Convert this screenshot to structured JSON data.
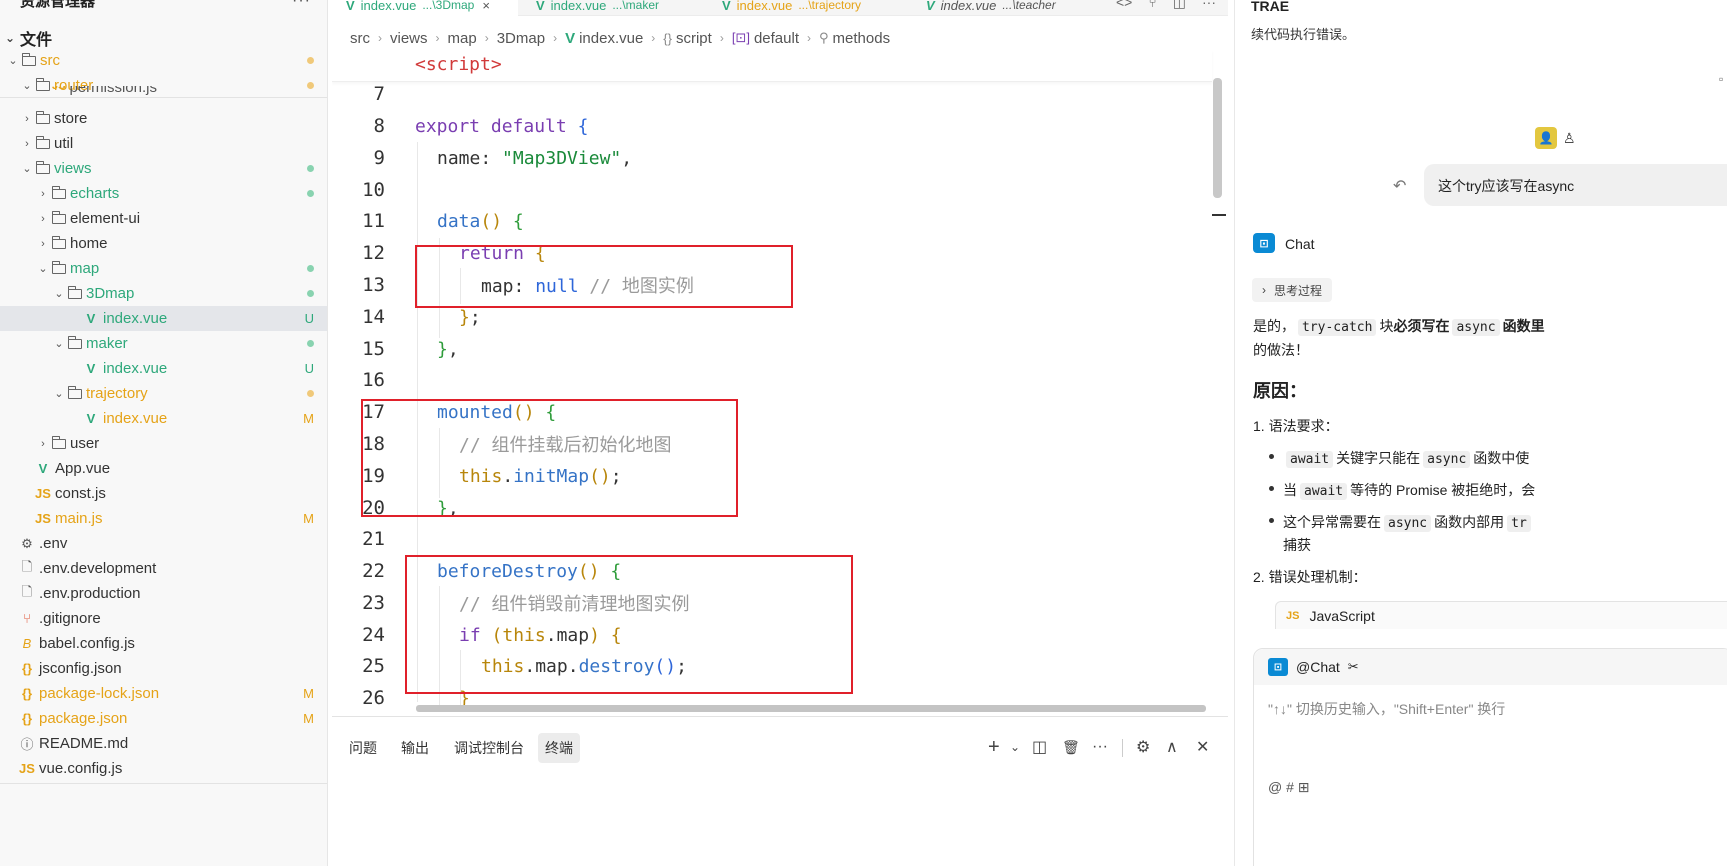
{
  "explorer": {
    "title": "资源管理器",
    "more": "···",
    "section": "文件",
    "rows": [
      {
        "label": "src",
        "color": "orange"
      },
      {
        "label": "router",
        "color": "orange"
      },
      {
        "label": "permission.js",
        "color": "gray"
      },
      {
        "label": "store",
        "color": "gray"
      },
      {
        "label": "util",
        "color": "gray"
      },
      {
        "label": "views",
        "color": "green"
      },
      {
        "label": "echarts",
        "color": "green"
      },
      {
        "label": "element-ui",
        "color": "gray"
      },
      {
        "label": "home",
        "color": "gray"
      },
      {
        "label": "map",
        "color": "green"
      },
      {
        "label": "3Dmap",
        "color": "green"
      },
      {
        "label": "index.vue",
        "color": "green",
        "status": "U"
      },
      {
        "label": "maker",
        "color": "green"
      },
      {
        "label": "index.vue",
        "color": "green",
        "status": "U"
      },
      {
        "label": "trajectory",
        "color": "orange"
      },
      {
        "label": "index.vue",
        "color": "orange",
        "status": "M"
      },
      {
        "label": "user",
        "color": "gray"
      },
      {
        "label": "App.vue",
        "color": "gray"
      },
      {
        "label": "const.js",
        "color": "gray"
      },
      {
        "label": "main.js",
        "color": "orange",
        "status": "M"
      },
      {
        "label": ".env",
        "color": "gray"
      },
      {
        "label": ".env.development",
        "color": "gray"
      },
      {
        "label": ".env.production",
        "color": "gray"
      },
      {
        "label": ".gitignore",
        "color": "gray"
      },
      {
        "label": "babel.config.js",
        "color": "gray"
      },
      {
        "label": "jsconfig.json",
        "color": "gray"
      },
      {
        "label": "package-lock.json",
        "color": "orange",
        "status": "M"
      },
      {
        "label": "package.json",
        "color": "orange",
        "status": "M"
      },
      {
        "label": "README.md",
        "color": "gray"
      },
      {
        "label": "vue.config.js",
        "color": "gray"
      }
    ],
    "accent_green": "#2ea87b",
    "accent_orange": "#e5a318"
  },
  "tabs": [
    {
      "name": "index.vue",
      "path": "...\\3Dmap",
      "close": "×"
    },
    {
      "name": "index.vue",
      "path": "...\\maker"
    },
    {
      "name": "index.vue",
      "path": "...\\trajectory"
    },
    {
      "name": "index.vue",
      "path": "...\\teacher"
    }
  ],
  "tab_actions": [
    "<>",
    "⑂",
    "◫",
    "···"
  ],
  "breadcrumb": {
    "parts": [
      "src",
      "views",
      "map",
      "3Dmap",
      "index.vue",
      "script",
      "default",
      "methods"
    ],
    "script_icon": "{}",
    "default_icon": "[⊡]",
    "methods_icon": "⚲"
  },
  "code": {
    "sticky": "<script>",
    "lines": [
      {
        "n": "7"
      },
      {
        "n": "8"
      },
      {
        "n": "9"
      },
      {
        "n": "10"
      },
      {
        "n": "11"
      },
      {
        "n": "12"
      },
      {
        "n": "13"
      },
      {
        "n": "14"
      },
      {
        "n": "15"
      },
      {
        "n": "16"
      },
      {
        "n": "17"
      },
      {
        "n": "18"
      },
      {
        "n": "19"
      },
      {
        "n": "20"
      },
      {
        "n": "21"
      },
      {
        "n": "22"
      },
      {
        "n": "23"
      },
      {
        "n": "24"
      },
      {
        "n": "25"
      },
      {
        "n": "26"
      }
    ],
    "tokens": {
      "export": "export",
      "default": "default",
      "name_key": "name: ",
      "name_val": "\"Map3DView\"",
      "data": "data",
      "return": "return",
      "map_key": "map: ",
      "null": "null",
      "cm_map": "// 地图实例",
      "mounted": "mounted",
      "cm_mounted": "// 组件挂载后初始化地图",
      "this": "this",
      "initMap": "initMap",
      "beforeDestroy": "beforeDestroy",
      "cm_destroy": "// 组件销毁前清理地图实例",
      "if": "if",
      "map": "map",
      "destroy": "destroy"
    }
  },
  "panel": {
    "tabs": [
      "问题",
      "输出",
      "调试控制台",
      "终端"
    ],
    "active": "终端",
    "actions": [
      "+",
      "⌄",
      "◫",
      "🗑",
      "···",
      "⚙",
      "∧",
      "✕"
    ]
  },
  "chat": {
    "brand": "TRAE",
    "cut_text": "续代码执行错误。",
    "user_message": "这个try应该写在async",
    "bot_name": "Chat",
    "think": "思考过程",
    "answer_line1_a": "是的，",
    "answer_line1_code": "try-catch",
    "answer_line1_b": "块",
    "answer_line1_bold": "必须写在",
    "answer_line1_code2": "async",
    "answer_line1_c": "函数里",
    "answer_line2": "的做法！",
    "heading": "原因：",
    "item1": "1. 语法要求：",
    "b1_code": "await",
    "b1_a": "关键字只能在",
    "b1_code2": "async",
    "b1_b": "函数中使",
    "b2_a": "当",
    "b2_code": "await",
    "b2_b": "等待的 Promise 被拒绝时，会",
    "b3_a": "这个异常需要在",
    "b3_code": "async",
    "b3_b": "函数内部用",
    "b3_code2": "tr",
    "b3_c": "捕获",
    "item2": "2. 错误处理机制：",
    "code_lang": "JavaScript",
    "code_badge": "JS",
    "input_head": "@Chat",
    "input_placeholder": "\"↑↓\" 切换历史输入，\"Shift+Enter\" 换行",
    "tools": "@  #  ⊞"
  }
}
